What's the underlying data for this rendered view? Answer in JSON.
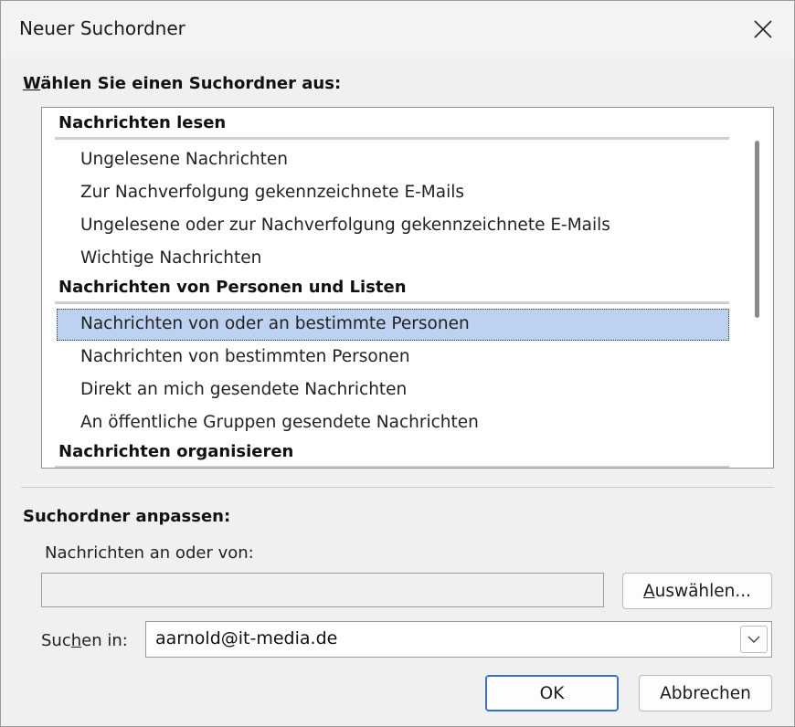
{
  "window": {
    "title": "Neuer Suchordner",
    "close_icon": "close-icon"
  },
  "choose_label": {
    "accel": "W",
    "rest": "ählen Sie einen Suchordner aus:"
  },
  "list": {
    "groups": [
      {
        "header": "Nachrichten lesen",
        "items": [
          "Ungelesene Nachrichten",
          "Zur Nachverfolgung gekennzeichnete E-Mails",
          "Ungelesene oder zur Nachverfolgung gekennzeichnete E-Mails",
          "Wichtige Nachrichten"
        ]
      },
      {
        "header": "Nachrichten von Personen und Listen",
        "items": [
          "Nachrichten von oder an bestimmte Personen",
          "Nachrichten von bestimmten Personen",
          "Direkt an mich gesendete Nachrichten",
          "An öffentliche Gruppen gesendete Nachrichten"
        ]
      },
      {
        "header": "Nachrichten organisieren",
        "items": []
      }
    ],
    "selected_item": "Nachrichten von oder an bestimmte Personen"
  },
  "customize": {
    "heading": "Suchordner anpassen:",
    "messages_label": "Nachrichten an oder von:",
    "messages_value": "",
    "select_button": {
      "accel": "A",
      "rest": "uswählen..."
    },
    "search_in_label": {
      "before": "Suc",
      "accel": "h",
      "after": "en in:"
    },
    "search_in_value": "aarnold@it-media.de"
  },
  "buttons": {
    "ok": "OK",
    "cancel": "Abbrechen"
  },
  "colors": {
    "selection": "#bcd2f0",
    "default_button_border": "#2f6fd6"
  }
}
